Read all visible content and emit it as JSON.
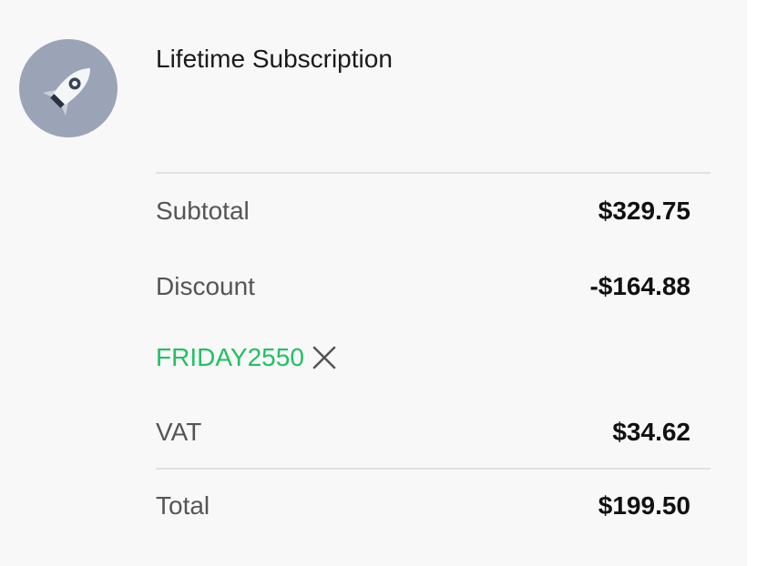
{
  "product": {
    "name": "Lifetime Subscription",
    "icon": "rocket-icon"
  },
  "summary": {
    "subtotal_label": "Subtotal",
    "subtotal_value": "$329.75",
    "discount_label": "Discount",
    "discount_value": "-$164.88",
    "coupon_code": "FRIDAY2550",
    "coupon_remove_icon": "close-icon",
    "vat_label": "VAT",
    "vat_value": "$34.62",
    "total_label": "Total",
    "total_value": "$199.50"
  },
  "colors": {
    "panel_background": "#f8f8f8",
    "avatar_background": "#9ba4b6",
    "coupon": "#22c063"
  }
}
